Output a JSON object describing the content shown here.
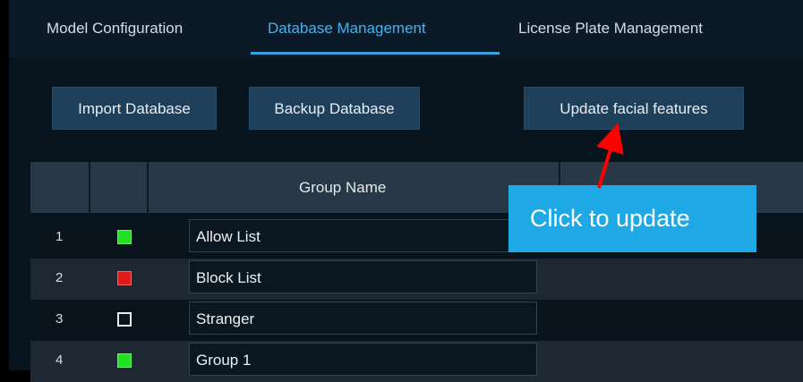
{
  "tabs": [
    {
      "label": "Model Configuration",
      "active": false
    },
    {
      "label": "Database Management",
      "active": true
    },
    {
      "label": "License Plate Management",
      "active": false
    }
  ],
  "buttons": {
    "import": "Import Database",
    "backup": "Backup Database",
    "update": "Update facial features"
  },
  "table": {
    "group_name_header": "Group Name",
    "rows": [
      {
        "index": "1",
        "name": "Allow List",
        "swatch_color": "#22e022"
      },
      {
        "index": "2",
        "name": "Block List",
        "swatch_color": "#e01919"
      },
      {
        "index": "3",
        "name": "Stranger",
        "swatch_color": "none"
      },
      {
        "index": "4",
        "name": "Group 1",
        "swatch_color": "#22e022"
      }
    ]
  },
  "callout": {
    "text": "Click to update",
    "color": "#1ea8e6",
    "arrow_color": "#ff0000"
  }
}
